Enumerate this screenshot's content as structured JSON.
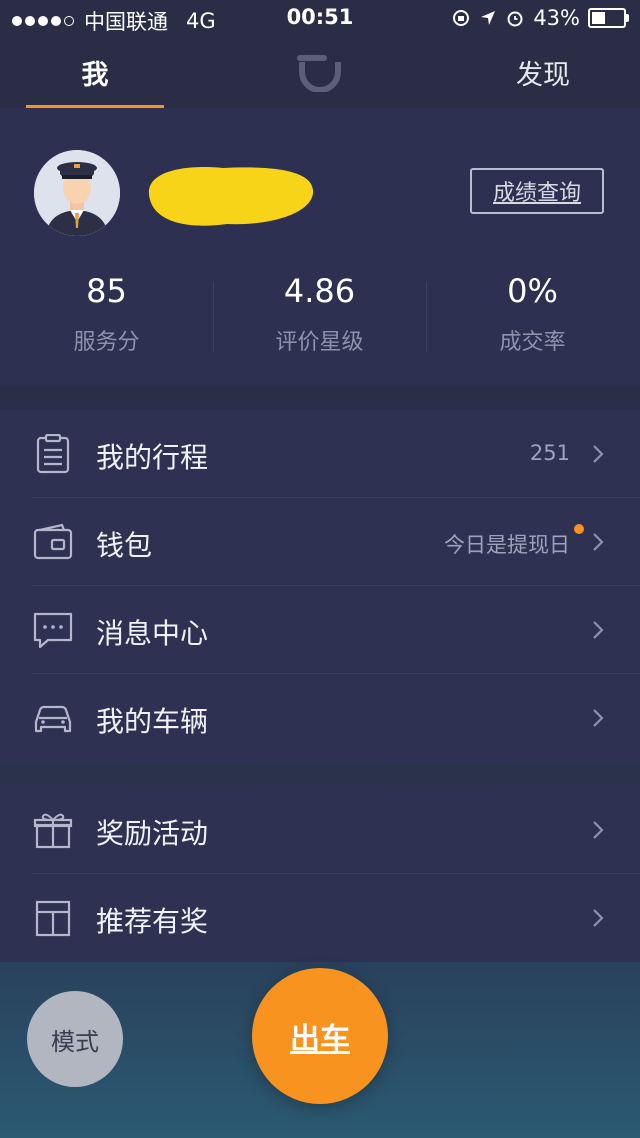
{
  "status_bar": {
    "carrier": "中国联通",
    "network": "4G",
    "time": "00:51",
    "battery": "43%"
  },
  "tabs": {
    "me": "我",
    "discover": "发现"
  },
  "profile": {
    "score_button": "成绩查询",
    "stats": [
      {
        "value": "85",
        "label": "服务分"
      },
      {
        "value": "4.86",
        "label": "评价星级"
      },
      {
        "value": "0%",
        "label": "成交率"
      }
    ]
  },
  "menu1": [
    {
      "label": "我的行程",
      "value": "251",
      "icon": "clipboard-icon"
    },
    {
      "label": "钱包",
      "value": "今日是提现日",
      "icon": "wallet-icon"
    },
    {
      "label": "消息中心",
      "value": "",
      "icon": "message-icon"
    },
    {
      "label": "我的车辆",
      "value": "",
      "icon": "car-icon"
    }
  ],
  "menu2": [
    {
      "label": "奖励活动",
      "value": "",
      "icon": "gift-icon"
    },
    {
      "label": "推荐有奖",
      "value": "",
      "icon": "box-icon"
    }
  ],
  "buttons": {
    "mode": "模式",
    "go": "出车"
  },
  "colors": {
    "accent": "#f7931e",
    "background": "#2b2e48",
    "panel": "#2e3152"
  }
}
